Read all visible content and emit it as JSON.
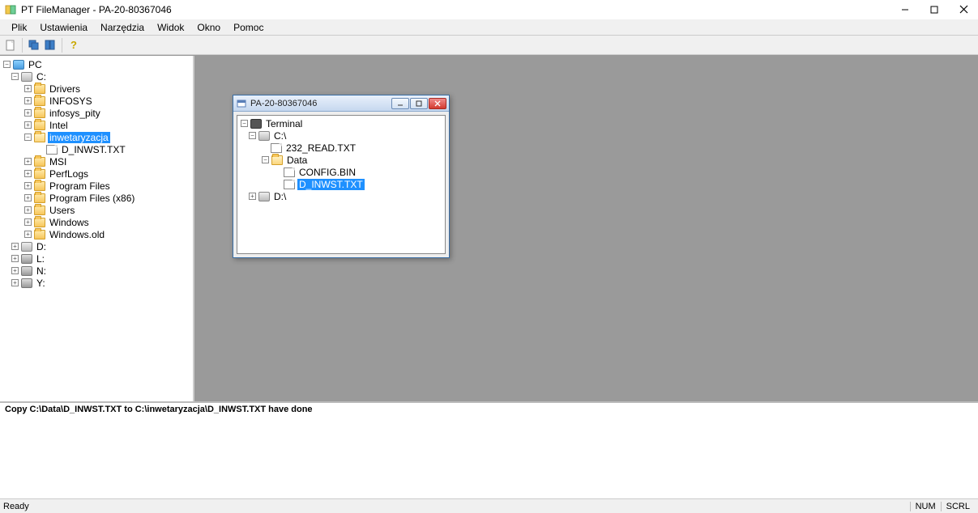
{
  "window": {
    "title": "PT FileManager - PA-20-80367046"
  },
  "menu": {
    "items": [
      "Plik",
      "Ustawienia",
      "Narzędzia",
      "Widok",
      "Okno",
      "Pomoc"
    ]
  },
  "toolbar": {
    "new": "new-document",
    "cascade": "cascade-windows",
    "tile": "tile-windows",
    "help": "?"
  },
  "left_tree": {
    "root": "PC",
    "c_drive": "C:",
    "folders": [
      "Drivers",
      "INFOSYS",
      "infosys_pity",
      "Intel",
      "inwetaryzacja",
      "MSI",
      "PerfLogs",
      "Program Files",
      "Program Files (x86)",
      "Users",
      "Windows",
      "Windows.old"
    ],
    "selected_file": "D_INWST.TXT",
    "d_drive": "D:",
    "l_drive": "L:",
    "n_drive": "N:",
    "y_drive": "Y:"
  },
  "subwindow": {
    "title": "PA-20-80367046",
    "tree": {
      "root": "Terminal",
      "c_drive": "C:\\",
      "file1": "232_READ.TXT",
      "data_folder": "Data",
      "config": "CONFIG.BIN",
      "selected_file": "D_INWST.TXT",
      "d_drive": "D:\\"
    }
  },
  "log": {
    "line1": "Copy C:\\Data\\D_INWST.TXT to C:\\inwetaryzacja\\D_INWST.TXT have done"
  },
  "status": {
    "ready": "Ready",
    "num": "NUM",
    "scrl": "SCRL"
  }
}
